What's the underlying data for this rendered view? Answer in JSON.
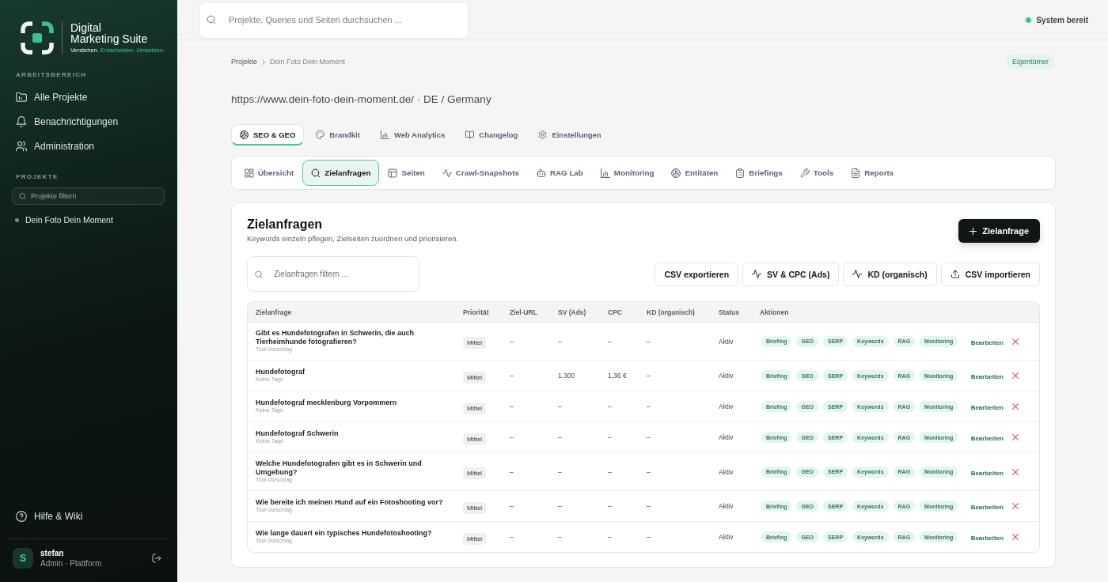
{
  "sidebar": {
    "logo": {
      "line_1": "Digital",
      "line_2": "Marketing Suite",
      "tagline_lead": "Verstehen.",
      "tagline_accent": "Entscheiden. Umsetzen."
    },
    "workspace_heading": "ARBEITSBEREICH",
    "workspace_items": [
      {
        "label": "Alle Projekte"
      },
      {
        "label": "Benachrichtigungen"
      },
      {
        "label": "Administration"
      }
    ],
    "projects_heading": "PROJEKTE",
    "project_filter": {
      "placeholder": "Projekte filtern"
    },
    "projects": [
      {
        "label": "Dein Foto Dein Moment"
      }
    ],
    "help": "Hilfe & Wiki",
    "user": {
      "avatar": "S",
      "name": "stefan",
      "role": "Admin · Plattform"
    }
  },
  "topbar": {
    "search": {
      "placeholder": "Projekte, Queries und Seiten durchsuchen ..."
    },
    "status": "System bereit"
  },
  "breadcrumb": [
    "Projekte",
    "Dein Foto Dein Moment"
  ],
  "role_badge": "Eigentümer",
  "project_url": "https://www.dein-foto-dein-moment.de/ · DE / Germany",
  "tabs": [
    {
      "label": "SEO & GEO",
      "selected": true
    },
    {
      "label": "Brandkit",
      "selected": false
    },
    {
      "label": "Web Analytics",
      "selected": false
    },
    {
      "label": "Changelog",
      "selected": false
    },
    {
      "label": "Einstellungen",
      "selected": false
    }
  ],
  "subtabs": [
    {
      "label": "Übersicht",
      "selected": false
    },
    {
      "label": "Zielanfragen",
      "selected": true
    },
    {
      "label": "Seiten",
      "selected": false
    },
    {
      "label": "Crawl-Snapshots",
      "selected": false
    },
    {
      "label": "RAG Lab",
      "selected": false
    },
    {
      "label": "Monitoring",
      "selected": false
    },
    {
      "label": "Entitäten",
      "selected": false
    },
    {
      "label": "Briefings",
      "selected": false
    },
    {
      "label": "Tools",
      "selected": false
    },
    {
      "label": "Reports",
      "selected": false
    }
  ],
  "panel": {
    "title": "Zielanfragen",
    "subtitle": "Keywords einzeln pflegen, Zielseiten zuordnen und priorisieren.",
    "add_button": "Zielanfrage",
    "filter": {
      "placeholder": "Zielanfragen filtern ..."
    },
    "toolbar_buttons": [
      "CSV exportieren",
      "SV & CPC (Ads)",
      "KD (organisch)",
      "CSV importieren"
    ],
    "table": {
      "columns": [
        "Zielanfrage",
        "Priorität",
        "Ziel-URL",
        "SV (Ads)",
        "CPC",
        "KD (organisch)",
        "Status",
        "Aktionen"
      ],
      "rows": [
        {
          "query": "Gibt es Hundefotografen in Schwerin, die auch Tierheimhunde fotografieren?",
          "note": "Tool-Vorschlag",
          "priority": "Mittel",
          "target_url": "–",
          "sv_ads": "–",
          "cpc": "–",
          "kd": "–",
          "status": "Aktiv",
          "actions": [
            "Briefing",
            "GEO",
            "SERP",
            "Keywords",
            "RAG",
            "Monitoring"
          ],
          "edit": "Bearbeiten"
        },
        {
          "query": "Hundefotograf",
          "note": "Keine Tags",
          "priority": "Mittel",
          "target_url": "–",
          "sv_ads": "1.300",
          "cpc": "1,36 €",
          "kd": "–",
          "status": "Aktiv",
          "actions": [
            "Briefing",
            "GEO",
            "SERP",
            "Keywords",
            "RAG",
            "Monitoring"
          ],
          "edit": "Bearbeiten"
        },
        {
          "query": "Hundefotograf mecklenburg Vorpommern",
          "note": "Keine Tags",
          "priority": "Mittel",
          "target_url": "–",
          "sv_ads": "–",
          "cpc": "–",
          "kd": "–",
          "status": "Aktiv",
          "actions": [
            "Briefing",
            "GEO",
            "SERP",
            "Keywords",
            "RAG",
            "Monitoring"
          ],
          "edit": "Bearbeiten"
        },
        {
          "query": "Hundefotograf Schwerin",
          "note": "Keine Tags",
          "priority": "Mittel",
          "target_url": "–",
          "sv_ads": "–",
          "cpc": "–",
          "kd": "–",
          "status": "Aktiv",
          "actions": [
            "Briefing",
            "GEO",
            "SERP",
            "Keywords",
            "RAG",
            "Monitoring"
          ],
          "edit": "Bearbeiten"
        },
        {
          "query": "Welche Hundefotografen gibt es in Schwerin und Umgebung?",
          "note": "Tool-Vorschlag",
          "priority": "Mittel",
          "target_url": "–",
          "sv_ads": "–",
          "cpc": "–",
          "kd": "–",
          "status": "Aktiv",
          "actions": [
            "Briefing",
            "GEO",
            "SERP",
            "Keywords",
            "RAG",
            "Monitoring"
          ],
          "edit": "Bearbeiten"
        },
        {
          "query": "Wie bereite ich meinen Hund auf ein Fotoshooting vor?",
          "note": "Tool-Vorschlag",
          "priority": "Mittel",
          "target_url": "–",
          "sv_ads": "–",
          "cpc": "–",
          "kd": "–",
          "status": "Aktiv",
          "actions": [
            "Briefing",
            "GEO",
            "SERP",
            "Keywords",
            "RAG",
            "Monitoring"
          ],
          "edit": "Bearbeiten"
        },
        {
          "query": "Wie lange dauert ein typisches Hundefotoshooting?",
          "note": "Tool-Vorschlag",
          "priority": "Mittel",
          "target_url": "–",
          "sv_ads": "–",
          "cpc": "–",
          "kd": "–",
          "status": "Aktiv",
          "actions": [
            "Briefing",
            "GEO",
            "SERP",
            "Keywords",
            "RAG",
            "Monitoring"
          ],
          "edit": "Bearbeiten"
        }
      ]
    }
  }
}
